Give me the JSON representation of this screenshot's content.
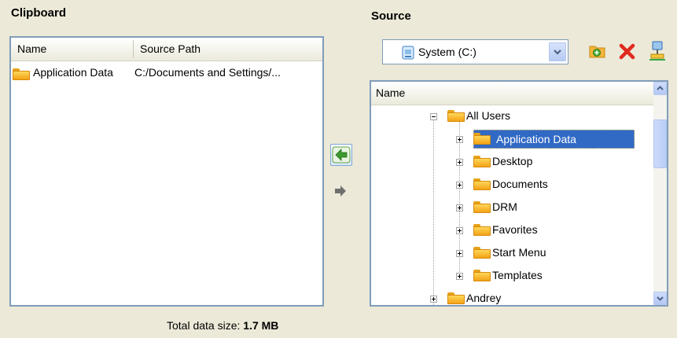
{
  "clipboard": {
    "title": "Clipboard",
    "columns": [
      "Name",
      "Source Path"
    ],
    "rows": [
      {
        "name": "Application Data",
        "path": "C:/Documents and Settings/..."
      }
    ],
    "total_label": "Total data size:",
    "total_value": "1.7 MB"
  },
  "source": {
    "title": "Source",
    "drive": "System (C:)",
    "tree_header": "Name",
    "tree": [
      {
        "label": "All Users",
        "level": 0,
        "expander": "minus",
        "selected": false
      },
      {
        "label": "Application Data",
        "level": 1,
        "expander": "plus",
        "selected": true
      },
      {
        "label": "Desktop",
        "level": 1,
        "expander": "plus",
        "selected": false
      },
      {
        "label": "Documents",
        "level": 1,
        "expander": "plus",
        "selected": false
      },
      {
        "label": "DRM",
        "level": 1,
        "expander": "plus",
        "selected": false
      },
      {
        "label": "Favorites",
        "level": 1,
        "expander": "plus",
        "selected": false
      },
      {
        "label": "Start Menu",
        "level": 1,
        "expander": "plus",
        "selected": false
      },
      {
        "label": "Templates",
        "level": 1,
        "expander": "plus",
        "selected": false
      },
      {
        "label": "Andrey",
        "level": 0,
        "expander": "plus",
        "selected": false
      }
    ]
  },
  "colors": {
    "selection": "#316ac5",
    "panel_border": "#7f9db9",
    "background": "#ece9d8"
  }
}
